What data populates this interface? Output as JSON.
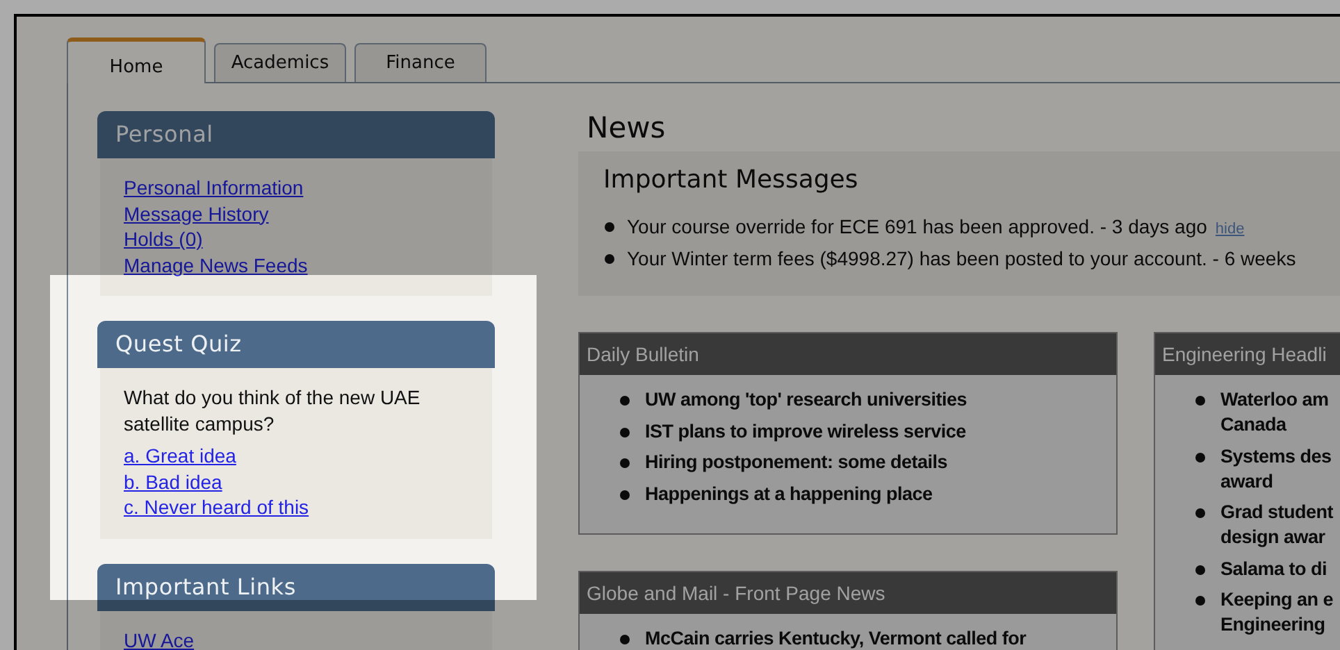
{
  "tabs": [
    {
      "label": "Home",
      "selected": true
    },
    {
      "label": "Academics",
      "selected": false
    },
    {
      "label": "Finance",
      "selected": false
    }
  ],
  "sidebar": {
    "panels": [
      {
        "title": "Personal",
        "kind": "links",
        "links": [
          "Personal Information",
          "Message History",
          "Holds (0)",
          "Manage News Feeds"
        ]
      },
      {
        "title": "Quest Quiz",
        "kind": "quiz",
        "question": "What do you think of the new UAE satellite campus?",
        "options": [
          "a. Great idea",
          "b. Bad idea",
          "c. Never heard of this"
        ]
      },
      {
        "title": "Important Links",
        "kind": "links",
        "links": [
          "UW Ace"
        ]
      }
    ]
  },
  "news": {
    "title": "News",
    "messages": {
      "title": "Important Messages",
      "items": [
        {
          "text": "Your course override for ECE 691 has been approved. - 3 days ago",
          "action": "hide"
        },
        {
          "text": "Your Winter term fees ($4998.27) has been posted to your account. - 6 weeks"
        }
      ]
    },
    "columns": [
      [
        {
          "title": "Daily Bulletin",
          "items": [
            {
              "lines": [
                "UW among 'top' research universities"
              ]
            },
            {
              "lines": [
                "IST plans to improve wireless service"
              ]
            },
            {
              "lines": [
                "Hiring postponement: some details"
              ]
            },
            {
              "lines": [
                "Happenings at a happening place"
              ]
            }
          ]
        },
        {
          "title": "Globe and Mail - Front Page News",
          "items": [
            {
              "lines": [
                "McCain carries Kentucky, Vermont called for"
              ]
            }
          ]
        }
      ],
      [
        {
          "title": "Engineering Headli",
          "items": [
            {
              "lines": [
                "Waterloo am",
                "Canada"
              ]
            },
            {
              "lines": [
                "Systems des",
                "award"
              ]
            },
            {
              "lines": [
                "Grad student",
                "design awar"
              ]
            },
            {
              "lines": [
                "Salama to di"
              ]
            },
            {
              "lines": [
                "Keeping an e",
                "Engineering"
              ]
            }
          ]
        }
      ]
    ]
  }
}
